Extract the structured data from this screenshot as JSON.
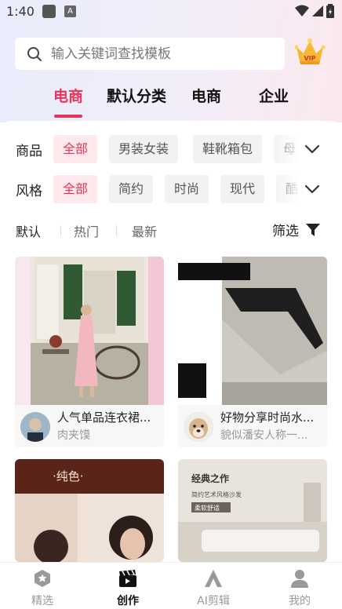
{
  "status": {
    "time": "1:40"
  },
  "search": {
    "placeholder": "输入关键词查找模板"
  },
  "vip": {
    "label": "VIP"
  },
  "tabs": [
    {
      "label": "电商",
      "active": true
    },
    {
      "label": "默认分类"
    },
    {
      "label": "电商"
    },
    {
      "label": "企业"
    }
  ],
  "filters": {
    "product": {
      "label": "商品",
      "chips": [
        "全部",
        "男装女装",
        "鞋靴箱包",
        "母"
      ]
    },
    "style": {
      "label": "风格",
      "chips": [
        "全部",
        "简约",
        "时尚",
        "现代",
        "酷"
      ]
    }
  },
  "sort": {
    "items": [
      "默认",
      "热门",
      "最新"
    ],
    "filter_label": "筛选"
  },
  "cards": [
    {
      "title": "人气单品连衣裙...",
      "author": "肉夹馍"
    },
    {
      "title": "好物分享时尚水...",
      "author": "貌似潘安人称一..."
    },
    {
      "overlay_text": "·纯色·"
    },
    {
      "overlay_title": "经典之作",
      "overlay_sub": "简约艺术风格沙发",
      "overlay_tag": "柔软舒适"
    }
  ],
  "nav": [
    {
      "label": "精选"
    },
    {
      "label": "创作",
      "active": true
    },
    {
      "label": "AI剪辑"
    },
    {
      "label": "我的"
    }
  ],
  "colors": {
    "accent": "#e8335b",
    "chip_active_bg": "#fde8ec"
  }
}
